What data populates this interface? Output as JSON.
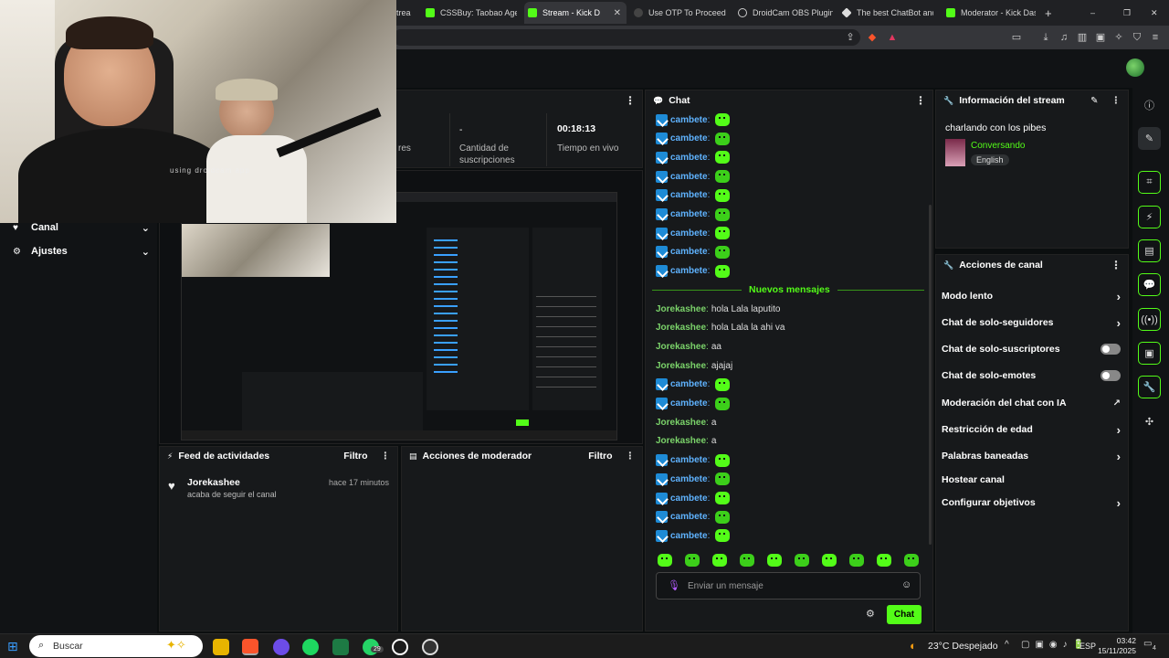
{
  "browser": {
    "tabs": [
      {
        "label": "trea",
        "color": "#53fc18"
      },
      {
        "label": "CSSBuy: Taobao Agent",
        "color": "#53fc18"
      },
      {
        "label": "Stream - Kick D",
        "color": "#53fc18"
      },
      {
        "label": "Use OTP To Proceed -",
        "color": "#888888"
      },
      {
        "label": "DroidCam OBS Plugin",
        "color": "#cccccc"
      },
      {
        "label": "The best ChatBot and",
        "color": "#dddddd"
      },
      {
        "label": "Moderator - Kick Dash",
        "color": "#53fc18"
      }
    ],
    "new_tab": "+"
  },
  "webcam": {
    "watermark": "using droidcam app"
  },
  "stats": {
    "followers_label": "res",
    "subs_value": "-",
    "subs_label": "Cantidad de suscripciones",
    "uptime_value": "00:18:13",
    "uptime_label": "Tiempo en vivo"
  },
  "left_nav": [
    {
      "label": "Canal",
      "icon": "heart-icon"
    },
    {
      "label": "Ajustes",
      "icon": "gear-icon"
    }
  ],
  "activity": {
    "title": "Feed de actividades",
    "filter": "Filtro",
    "user": "Jorekashee",
    "time": "hace 17 minutos",
    "text": "acaba de seguir el canal"
  },
  "mod_actions": {
    "title": "Acciones de moderador",
    "filter": "Filtro"
  },
  "chat": {
    "title": "Chat",
    "messages": [
      {
        "user": "cambete",
        "text": "",
        "emote": true,
        "badge": true
      },
      {
        "user": "cambete",
        "text": "",
        "emote": true,
        "badge": true
      },
      {
        "user": "cambete",
        "text": "",
        "emote": true,
        "badge": true
      },
      {
        "user": "cambete",
        "text": "",
        "emote": true,
        "badge": true
      },
      {
        "user": "cambete",
        "text": "",
        "emote": true,
        "badge": true
      },
      {
        "user": "cambete",
        "text": "",
        "emote": true,
        "badge": true
      },
      {
        "user": "cambete",
        "text": "",
        "emote": true,
        "badge": true
      },
      {
        "user": "cambete",
        "text": "",
        "emote": true,
        "badge": true
      },
      {
        "user": "cambete",
        "text": "",
        "emote": true,
        "badge": true
      }
    ],
    "new_messages_label": "Nuevos mensajes",
    "messages2": [
      {
        "user": "Jorekashee",
        "text": "hola Lala laputito",
        "emote": false,
        "badge": false
      },
      {
        "user": "Jorekashee",
        "text": "hola Lala la ahi va",
        "emote": false,
        "badge": false
      },
      {
        "user": "Jorekashee",
        "text": "aa",
        "emote": false,
        "badge": false
      },
      {
        "user": "Jorekashee",
        "text": "ajajaj",
        "emote": false,
        "badge": false
      },
      {
        "user": "cambete",
        "text": "",
        "emote": true,
        "badge": true
      },
      {
        "user": "cambete",
        "text": "",
        "emote": true,
        "badge": true
      },
      {
        "user": "Jorekashee",
        "text": "a",
        "emote": false,
        "badge": false
      },
      {
        "user": "Jorekashee",
        "text": "a",
        "emote": false,
        "badge": false
      },
      {
        "user": "cambete",
        "text": "",
        "emote": true,
        "badge": true
      },
      {
        "user": "cambete",
        "text": "",
        "emote": true,
        "badge": true
      },
      {
        "user": "cambete",
        "text": "",
        "emote": true,
        "badge": true
      },
      {
        "user": "cambete",
        "text": "",
        "emote": true,
        "badge": true
      },
      {
        "user": "cambete",
        "text": "",
        "emote": true,
        "badge": true
      }
    ],
    "input_placeholder": "Enviar un mensaje",
    "send_button": "Chat"
  },
  "stream_info": {
    "title": "Información del stream",
    "stream_title": "charlando con los pibes",
    "category": "Conversando",
    "language": "English"
  },
  "channel_actions": {
    "title": "Acciones de canal",
    "items": [
      {
        "label": "Modo lento",
        "kind": "chevron"
      },
      {
        "label": "Chat de solo-seguidores",
        "kind": "chevron"
      },
      {
        "label": "Chat de solo-suscriptores",
        "kind": "toggle"
      },
      {
        "label": "Chat de solo-emotes",
        "kind": "toggle"
      },
      {
        "label": "Moderación del chat con IA",
        "kind": "external"
      },
      {
        "label": "Restricción de edad",
        "kind": "chevron"
      },
      {
        "label": "Palabras baneadas",
        "kind": "chevron"
      },
      {
        "label": "Hostear canal",
        "kind": "none"
      },
      {
        "label": "Configurar objetivos",
        "kind": "chevron"
      }
    ]
  },
  "taskbar": {
    "search": "Buscar",
    "weather": "23°C  Despejado",
    "lang": "ESP",
    "time": "03:42",
    "date": "15/11/2025",
    "whatsapp_badge": "29",
    "notif": "4"
  },
  "colors": {
    "kick_green": "#53fc18",
    "username_blue": "#5fb3ff",
    "username_green": "#7bd36a"
  }
}
